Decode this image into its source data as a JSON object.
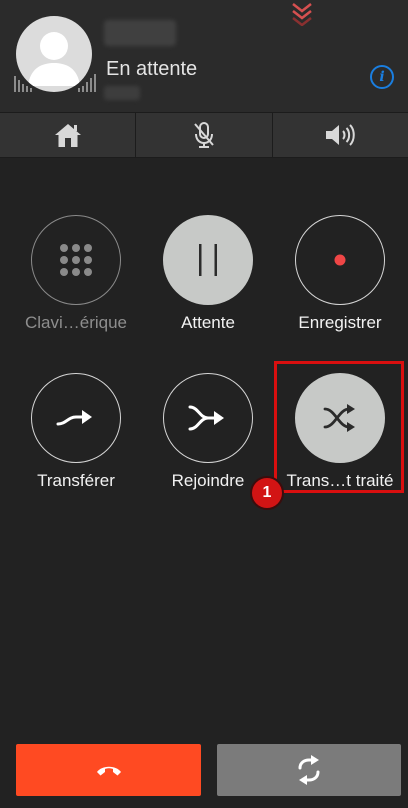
{
  "call": {
    "status": "En attente",
    "info_icon": "info-icon",
    "colors": {
      "accent": "#1a7ee0",
      "hangup": "#ff4a22",
      "highlight": "#d90f0f"
    }
  },
  "action_bar": {
    "items": [
      {
        "icon": "home-icon"
      },
      {
        "icon": "microphone-muted-icon"
      },
      {
        "icon": "speaker-icon"
      }
    ]
  },
  "controls": {
    "keypad_label": "Clavi…érique",
    "hold_label": "Attente",
    "record_label": "Enregistrer",
    "transfer_label": "Transférer",
    "join_label": "Rejoindre",
    "transfer_assisted_label": "Trans…t traité"
  },
  "annotation": {
    "badge": "1"
  },
  "bottom": {
    "hangup_icon": "phone-hangup-icon",
    "swap_icon": "swap-calls-icon"
  }
}
